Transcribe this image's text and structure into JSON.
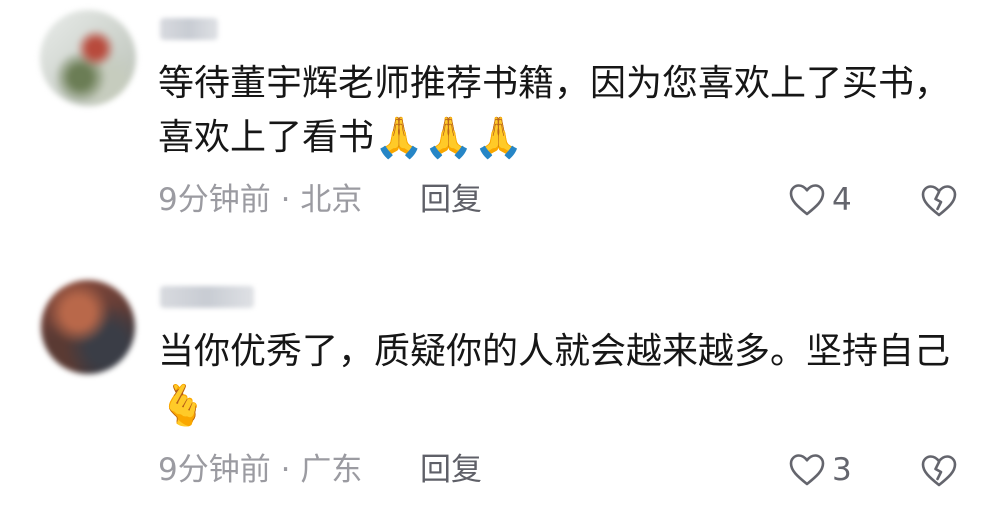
{
  "comments": [
    {
      "text": "等待董宇辉老师推荐书籍，因为您喜欢上了买书，喜欢上了看书",
      "emoji": "🙏🙏🙏",
      "emoji_icon": "folded-hands-icon",
      "time": "9分钟前",
      "location": "北京",
      "reply_label": "回复",
      "likes": "4"
    },
    {
      "text": "当你优秀了，质疑你的人就会越来越多。坚持自己",
      "emoji": "🫰",
      "emoji_icon": "finger-heart-icon",
      "time": "9分钟前",
      "location": "广东",
      "reply_label": "回复",
      "likes": "3"
    }
  ],
  "meta_separator": "·",
  "colors": {
    "text": "#161616",
    "meta": "#9b9ba1",
    "reply": "#5f6068",
    "icon": "#64656d"
  }
}
